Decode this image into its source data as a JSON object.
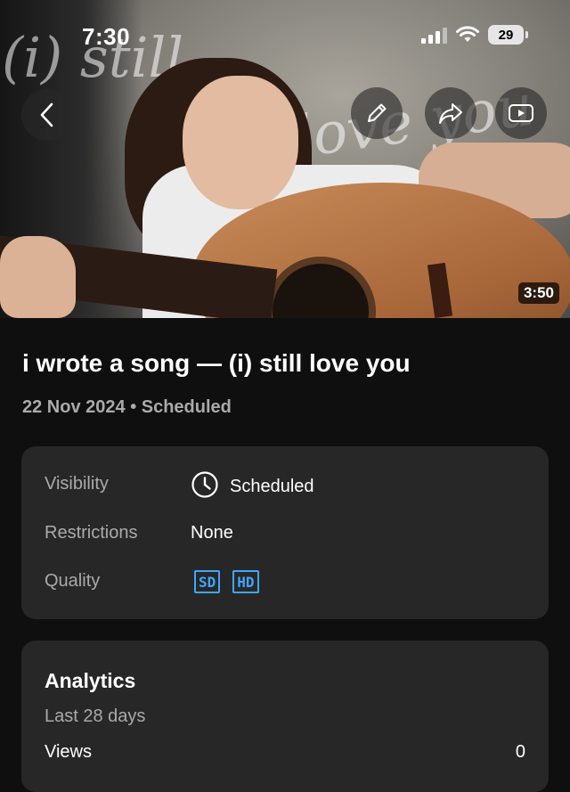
{
  "status_bar": {
    "time": "7:30",
    "battery": "29"
  },
  "video": {
    "overlay_script_left": "(i) still",
    "overlay_script_right": "love you",
    "duration": "3:50"
  },
  "icons": {
    "back": "back-chevron-icon",
    "edit": "pencil-icon",
    "share": "share-arrow-icon",
    "watch": "play-video-icon",
    "visibility": "clock-icon"
  },
  "title": "i wrote a song — (i) still love you",
  "meta": "22 Nov 2024 • Scheduled",
  "details": {
    "visibility_label": "Visibility",
    "visibility_value": "Scheduled",
    "restrictions_label": "Restrictions",
    "restrictions_value": "None",
    "quality_label": "Quality",
    "quality_badges": [
      "SD",
      "HD"
    ]
  },
  "analytics": {
    "title": "Analytics",
    "period": "Last 28 days",
    "views_label": "Views",
    "views_value": "0"
  },
  "colors": {
    "background": "#0f0f0f",
    "card": "#272727",
    "accent": "#3ea6ff",
    "muted": "#aaaaaa"
  }
}
